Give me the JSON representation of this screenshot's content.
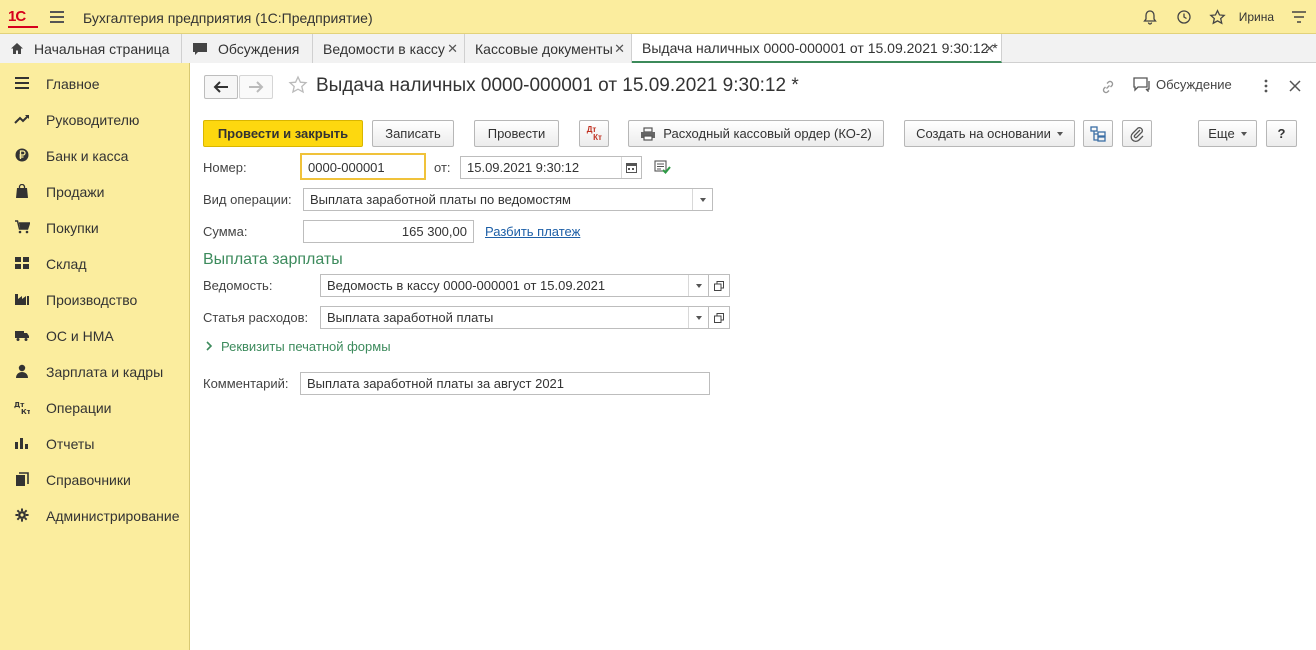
{
  "app": {
    "logo_text": "1С",
    "title": "Бухгалтерия предприятия (1С:Предприятие)",
    "user": "Ирина"
  },
  "tabs": [
    {
      "label": "Начальная страница"
    },
    {
      "label": "Обсуждения"
    },
    {
      "label": "Ведомости в кассу"
    },
    {
      "label": "Кассовые документы"
    },
    {
      "label": "Выдача наличных 0000-000001 от 15.09.2021 9:30:12 *"
    }
  ],
  "sidebar": {
    "items": [
      {
        "label": "Главное",
        "icon": "menu-list-icon"
      },
      {
        "label": "Руководителю",
        "icon": "trend-icon"
      },
      {
        "label": "Банк и касса",
        "icon": "ruble-icon"
      },
      {
        "label": "Продажи",
        "icon": "shopping-bag-icon"
      },
      {
        "label": "Покупки",
        "icon": "cart-icon"
      },
      {
        "label": "Склад",
        "icon": "warehouse-icon"
      },
      {
        "label": "Производство",
        "icon": "factory-icon"
      },
      {
        "label": "ОС и НМА",
        "icon": "truck-icon"
      },
      {
        "label": "Зарплата и кадры",
        "icon": "person-icon"
      },
      {
        "label": "Операции",
        "icon": "dt-kt-icon"
      },
      {
        "label": "Отчеты",
        "icon": "bar-chart-icon"
      },
      {
        "label": "Справочники",
        "icon": "books-icon"
      },
      {
        "label": "Администрирование",
        "icon": "gear-icon"
      }
    ]
  },
  "document": {
    "title": "Выдача наличных 0000-000001 от 15.09.2021 9:30:12 *",
    "discussion_label": "Обсуждение"
  },
  "toolbar": {
    "post_and_close": "Провести и закрыть",
    "save": "Записать",
    "post": "Провести",
    "dtkt_top": "Дт",
    "dtkt_bottom": "Кт",
    "print_order": "Расходный кассовый ордер (КО-2)",
    "create_based": "Создать на основании",
    "more": "Еще",
    "help": "?"
  },
  "form": {
    "number_label": "Номер:",
    "number_value": "0000-000001",
    "date_label": "от:",
    "date_value": "15.09.2021  9:30:12",
    "operation_label": "Вид операции:",
    "operation_value": "Выплата заработной платы по ведомостям",
    "sum_label": "Сумма:",
    "sum_value": "165 300,00",
    "split_link": "Разбить платеж",
    "section_title": "Выплата зарплаты",
    "statement_label": "Ведомость:",
    "statement_value": "Ведомость в кассу 0000-000001 от 15.09.2021",
    "expense_label": "Статья расходов:",
    "expense_value": "Выплата заработной платы",
    "print_details": "Реквизиты печатной формы",
    "comment_label": "Комментарий:",
    "comment_value": "Выплата заработной платы за август 2021"
  }
}
